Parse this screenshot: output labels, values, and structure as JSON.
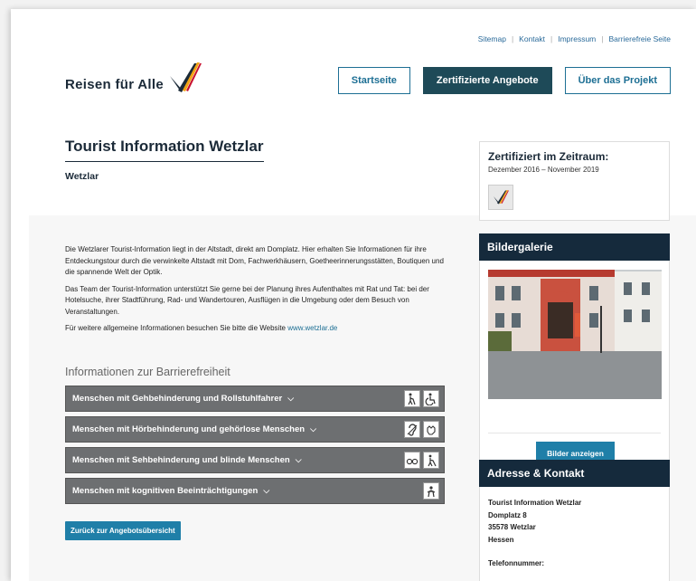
{
  "topnav": {
    "items": [
      "Sitemap",
      "Kontakt",
      "Impressum",
      "Barrierefreie Seite"
    ]
  },
  "logo": {
    "text": "Reisen für Alle"
  },
  "mainnav": {
    "startseite": "Startseite",
    "zertifizierte": "Zertifizierte Angebote",
    "projekt": "Über das Projekt"
  },
  "header": {
    "title": "Tourist Information Wetzlar",
    "subtitle": "Wetzlar"
  },
  "description": {
    "p1": "Die Wetzlarer Tourist-Information liegt in der Altstadt, direkt am Domplatz. Hier erhalten Sie Informationen für ihre Entdeckungstour durch die verwinkelte Altstadt mit Dom, Fachwerkhäusern, Goetheerinnerungsstätten, Boutiquen und die spannende Welt der Optik.",
    "p2": "Das Team der Tourist-Information unterstützt Sie gerne bei der Planung ihres Aufenthaltes mit Rat und Tat: bei der Hotelsuche, ihrer Stadtführung, Rad- und Wandertouren, Ausflügen in die Umgebung oder dem Besuch von Veranstaltungen.",
    "p3_prefix": "Für weitere allgemeine Informationen besuchen Sie bitte die Website",
    "p3_link": "www.wetzlar.de"
  },
  "accessibility": {
    "heading": "Informationen zur Barrierefreiheit",
    "items": [
      {
        "label": "Menschen mit Gehbehinderung und Rollstuhlfahrer",
        "icons": [
          "walking-aid-icon",
          "wheelchair-icon"
        ]
      },
      {
        "label": "Menschen mit Hörbehinderung und gehörlose Menschen",
        "icons": [
          "hearing-icon",
          "sign-language-icon"
        ]
      },
      {
        "label": "Menschen mit Sehbehinderung und blinde Menschen",
        "icons": [
          "glasses-icon",
          "white-cane-icon"
        ]
      },
      {
        "label": "Menschen mit kognitiven Beeinträchtigungen",
        "icons": [
          "cognitive-icon"
        ]
      }
    ]
  },
  "back_button": "Zurück zur Angebotsübersicht",
  "certification": {
    "title": "Zertifiziert im Zeitraum:",
    "range": "Dezember 2016 – November 2019"
  },
  "gallery": {
    "title": "Bildergalerie",
    "button": "Bilder anzeigen"
  },
  "contact": {
    "title": "Adresse & Kontakt",
    "name": "Tourist Information Wetzlar",
    "street": "Domplatz 8",
    "city": "35578 Wetzlar",
    "state": "Hessen",
    "phone_label": "Telefonnummer:"
  },
  "colors": {
    "brand_dark": "#152a3c",
    "accent_blue": "#1f7fa8",
    "accordion_grey": "#6d6f71",
    "logo_orange": "#f2a413",
    "logo_red": "#c8102e"
  }
}
